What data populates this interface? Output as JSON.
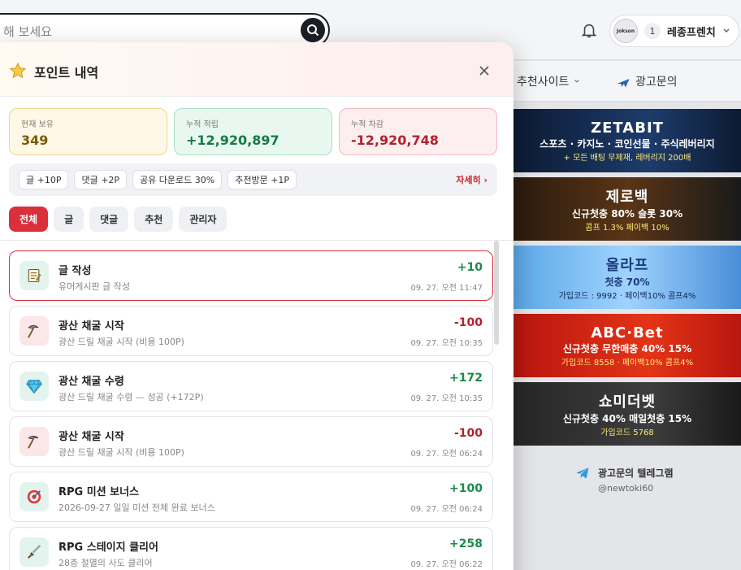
{
  "page": {
    "search_placeholder": "해 보세요",
    "notifications_icon": "bell-icon",
    "user": {
      "avatar_text": "Jokson",
      "level": "1",
      "name": "레종프렌치"
    },
    "nav": [
      {
        "label": "추천사이트",
        "icon": "chevron-down-icon"
      },
      {
        "label": "광고문의",
        "icon": "airplane-icon"
      }
    ],
    "banners": [
      {
        "title": "ZETABIT",
        "line": "스포츠 · 카지노 · 코인선물 · 주식레버리지",
        "sub": "+ 모든 배팅 무제재, 레버리지 200배"
      },
      {
        "title": "제로백",
        "line": "신규첫충 80% 슬롯 30%",
        "sub": "콤프 1.3% 페이백 10%"
      },
      {
        "title": "올라프",
        "line": "첫충 70%",
        "sub": "가입코드 : 9992 · 페이백10% 콤프4%"
      },
      {
        "title": "ABC·Bet",
        "line": "신규첫충 무한매충 40% 15%",
        "sub": "가입코드 8558 · 페이백10% 콤프4%"
      },
      {
        "title": "쇼미더벳",
        "line": "신규첫충 40% 매일첫충 15%",
        "sub": "가입코드 5768"
      }
    ],
    "telegram": {
      "title": "광고문의 텔레그램",
      "handle": "@newtoki60"
    }
  },
  "modal": {
    "title": "포인트 내역",
    "stats": {
      "hold_label": "현재 보유",
      "hold_value": "349",
      "earn_label": "누적 적립",
      "earn_value": "+12,920,897",
      "spend_label": "누적 차감",
      "spend_value": "-12,920,748"
    },
    "rules": [
      "글 +10P",
      "댓글 +2P",
      "공유 다운로드 30%",
      "추천방문 +1P"
    ],
    "rules_more": "자세히 ›",
    "tabs": [
      "전체",
      "글",
      "댓글",
      "추천",
      "관리자"
    ],
    "active_tab": "전체",
    "items": [
      {
        "icon": "memo-icon",
        "title": "글 작성",
        "desc": "유머게시판 글 작성",
        "amount": "+10",
        "date": "09. 27. 오전 11:47",
        "positive": true
      },
      {
        "icon": "pickaxe-icon",
        "title": "광산 채굴 시작",
        "desc": "광산 드릴 채굴 시작 (비용 100P)",
        "amount": "-100",
        "date": "09. 27. 오전 10:35",
        "positive": false
      },
      {
        "icon": "diamond-icon",
        "title": "광산 채굴 수령",
        "desc": "광산 드릴 채굴 수령 — 성공 (+172P)",
        "amount": "+172",
        "date": "09. 27. 오전 10:35",
        "positive": true
      },
      {
        "icon": "pickaxe-icon",
        "title": "광산 채굴 시작",
        "desc": "광산 드릴 채굴 시작 (비용 100P)",
        "amount": "-100",
        "date": "09. 27. 오전 06:24",
        "positive": false
      },
      {
        "icon": "target-icon",
        "title": "RPG 미션 보너스",
        "desc": "2026-09-27 일일 미션 전체 완료 보너스",
        "amount": "+100",
        "date": "09. 27. 오전 06:24",
        "positive": true
      },
      {
        "icon": "sword-icon",
        "title": "RPG 스테이지 클리어",
        "desc": "28층 절멸의 사도 클리어",
        "amount": "+258",
        "date": "09. 27. 오전 06:22",
        "positive": true
      }
    ]
  }
}
